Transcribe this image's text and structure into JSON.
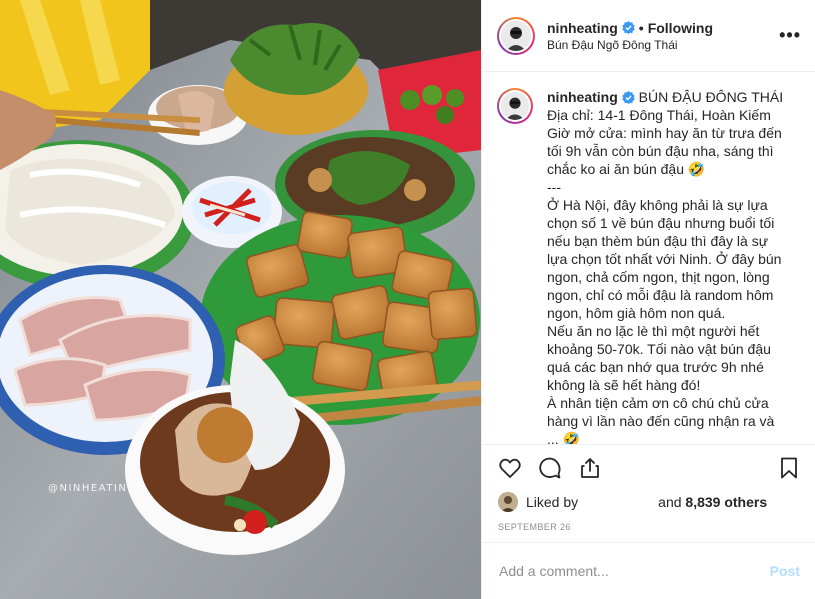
{
  "header": {
    "username": "ninheating",
    "follow_status": "Following",
    "location": "Bún Đậu Ngõ Đông Thái",
    "more_icon": "ellipsis-icon",
    "verified_icon": "verified-badge-icon"
  },
  "caption": {
    "username": "ninheating",
    "lines": [
      "BÚN ĐẬU ĐÔNG THÁI",
      "Địa chỉ: 14-1 Đông Thái, Hoàn Kiếm",
      "Giờ mở cửa: mình hay ăn từ trưa đến",
      "tối 9h vẫn còn bún đậu nha, sáng thì",
      "chắc ko ai ăn bún đậu 🤣",
      "---",
      "Ở Hà Nội, đây không phải là sự lựa",
      "chọn số 1 về bún đậu nhưng buổi tối",
      "nếu bạn thèm bún đậu thì đây là sự",
      "lựa chọn tốt nhất với Ninh. Ở đây bún",
      "ngon, chả cốm ngon, thịt ngon, lòng",
      "ngon, chỉ có mỗi đậu là random hôm",
      "ngon, hôm già hôm non quá.",
      "Nếu ăn no lặc lè thì một người hết",
      "khoảng 50-70k. Tối nào vật bún đậu",
      "quá các bạn nhớ qua trước 9h nhé",
      "không là sẽ hết hàng đó!",
      "À nhân tiện cảm ơn cô chú chủ cửa",
      "hàng vì lần nào đến cũng nhận ra và",
      "...  🤣"
    ]
  },
  "actions": {
    "like_icon": "heart-icon",
    "comment_icon": "comment-bubble-icon",
    "share_icon": "share-icon",
    "save_icon": "bookmark-icon"
  },
  "likes": {
    "liked_by": "Liked by",
    "and_others": "and",
    "count": "8,839 others"
  },
  "date": "SEPTEMBER 26",
  "comment": {
    "placeholder": "Add a comment...",
    "post_label": "Post"
  },
  "photo": {
    "watermark": "@NINHEATING"
  },
  "colors": {
    "verified": "#3897f0",
    "post_disabled": "#b2dffc",
    "meta_gray": "#8e8e8e",
    "divider": "#efefef"
  }
}
